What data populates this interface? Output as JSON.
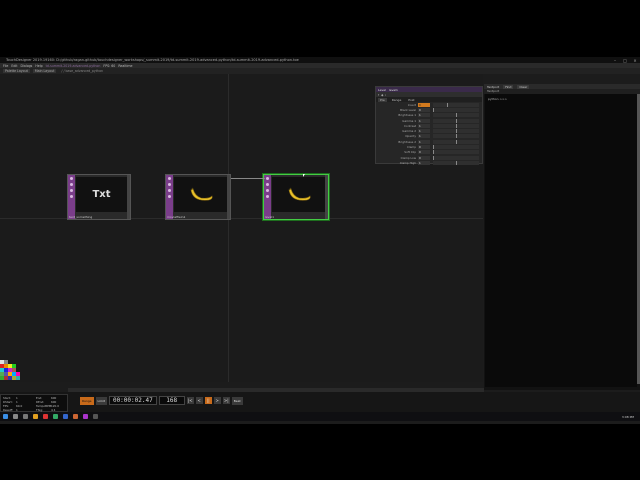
{
  "window": {
    "title": "TouchDesigner 2019.19160: D:/github/ragan-github/touchdesigner_workshops/_summit-2019/td-summit-2019-advanced-python/td-summit-2019-advanced-python.toe",
    "minimize_icon": "minimize-icon",
    "maximize_icon": "maximize-icon",
    "close_icon": "close-icon"
  },
  "menubar": {
    "items": [
      "File",
      "Edit",
      "Dialogs",
      "Help"
    ],
    "center_text": "td-summit-2019-advanced-python",
    "fps_label": "FPS: 60",
    "realtime_label": "Realtime"
  },
  "toolbar": {
    "buttons": [
      "Palette Layout",
      "Main Layout"
    ],
    "path": "/ / base_advanced_python"
  },
  "nodes": [
    {
      "label": "text_something",
      "preview_text": "Txt",
      "selected": false
    },
    {
      "label": "moviefilein1",
      "preview_text": "",
      "selected": false
    },
    {
      "label": "level1",
      "preview_text": "",
      "selected": true
    }
  ],
  "param": {
    "op_name": "level1",
    "type": "Level",
    "tabs": [
      "Pre",
      "Range",
      "Post"
    ],
    "rows": [
      {
        "label": "Invert",
        "value": "0"
      },
      {
        "label": "Black Level",
        "value": "0"
      },
      {
        "label": "Brightness 1",
        "value": "1"
      },
      {
        "label": "Gamma 1",
        "value": "1"
      },
      {
        "label": "Contrast",
        "value": "1"
      },
      {
        "label": "Gamma 2",
        "value": "1"
      },
      {
        "label": "Opacity",
        "value": "1"
      },
      {
        "label": "Brightness 2",
        "value": "1"
      },
      {
        "label": "Clamp",
        "value": "0"
      },
      {
        "label": "Soft Clip",
        "value": "0"
      },
      {
        "label": "Clamp Low",
        "value": "0"
      },
      {
        "label": "Clamp High",
        "value": "1"
      }
    ]
  },
  "right_panel": {
    "tab": "Textport",
    "buttons": [
      "Find",
      "Clear"
    ],
    "subheader": "Textport",
    "lines": [
      "python >>>"
    ]
  },
  "info_panel": {
    "rows": [
      [
        "Start:",
        "1",
        "End:",
        "600"
      ],
      [
        "RStart:",
        "1",
        "REnd:",
        "600"
      ],
      [
        "FPS:",
        "60.0",
        "TempoBPM:",
        "120.0"
      ],
      [
        "ResetF:",
        "1",
        "TSig:",
        "4 4"
      ]
    ]
  },
  "transport": {
    "range_label": "Range",
    "limit_label": "Limit",
    "timecode": "00:00:02.47",
    "frame": "168",
    "beat_label": "Beat",
    "play_controls": [
      "|<",
      "<",
      "||",
      ">",
      ">|"
    ]
  },
  "taskbar": {
    "time": "3:08 PM"
  }
}
